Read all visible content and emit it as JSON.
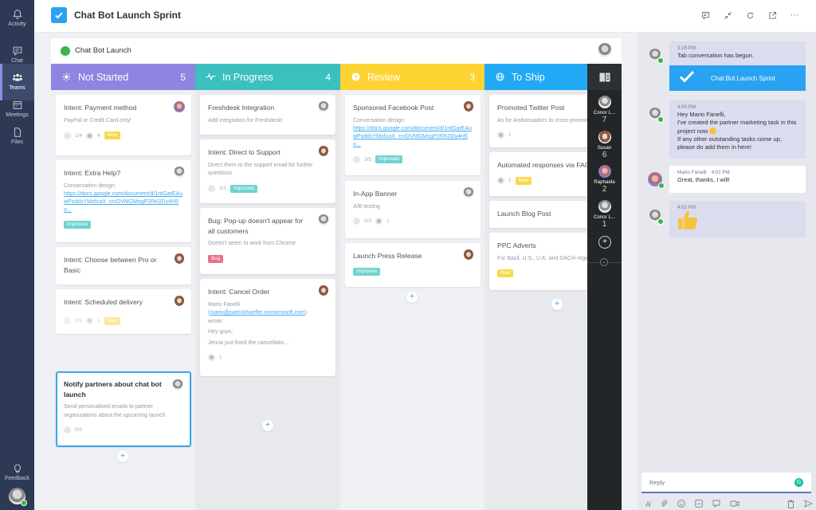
{
  "rail": {
    "items": [
      {
        "label": "Activity",
        "icon": "bell-icon"
      },
      {
        "label": "Chat",
        "icon": "chat-icon"
      },
      {
        "label": "Teams",
        "icon": "teams-icon",
        "active": true
      },
      {
        "label": "Meetings",
        "icon": "calendar-icon"
      },
      {
        "label": "Files",
        "icon": "file-icon"
      }
    ],
    "feedback": "Feedback"
  },
  "header": {
    "title": "Chat Bot Launch Sprint",
    "actions": [
      "conversation-icon",
      "collapse-icon",
      "refresh-icon",
      "popout-icon",
      "more-icon"
    ],
    "more": "···"
  },
  "board": {
    "project": "Chat Bot Launch",
    "columns": [
      {
        "name": "Not Started",
        "count": "5",
        "color": "#8f84e0",
        "icon": "lightbulb-icon",
        "cards": [
          {
            "title": "Intent: Payment method",
            "desc": "PayPal or Credit Card only!",
            "checklist": "1/4",
            "comments": "4",
            "tag": "New"
          },
          {
            "title": "Intent: Extra Help?",
            "desc": "Conversation design:",
            "link": "https://docs.google.com/document/d/1ntGarEAuwPxddxYMofcaX_crvDVMGMsgP2RK0Dy4H5o...",
            "tag": "Improved"
          },
          {
            "title": "Intent: Choose between Pro or Basic"
          },
          {
            "title": "Intent: Scheduled delivery",
            "checklist": "0/3",
            "comments": "1",
            "tag": "New"
          },
          {
            "title": "Notify partners about chat bot launch",
            "desc": "Send personalised emails to partner organizations about the upcoming launch",
            "checklist": "0/3"
          }
        ]
      },
      {
        "name": "In Progress",
        "count": "4",
        "color": "#3cbfbf",
        "icon": "activity-icon",
        "cards": [
          {
            "title": "Freshdesk Integration",
            "desc": "Add integration for Freshdesk!"
          },
          {
            "title": "Intent: Direct to Support",
            "desc": "Direct them to the support email for further questions",
            "checklist": "1/3",
            "tag": "Improved"
          },
          {
            "title": "Bug: Pop-up doesn't appear for all customers",
            "desc": "Doesn't seem to work from Chrome",
            "tag": "Bug"
          },
          {
            "title": "Intent: Cancel Order",
            "desc_line1": "Mario Fanelli",
            "email": "mario@patrickhoefler.onmicrosoft.com",
            "desc_line2": "wrote:",
            "desc_line3": "Hey guys,",
            "desc_line4": "Jenna just fixed the cancellatio...",
            "comments": "1"
          }
        ]
      },
      {
        "name": "Review",
        "count": "3",
        "color": "#fdd333",
        "icon": "question-icon",
        "cards": [
          {
            "title": "Sponsored Facebook Post",
            "desc": "Conversation design:",
            "link": "https://docs.google.com/document/d/1ntGarEAuwPxddxYMofcaX_crvDVMGMsgP2RK0Dy4H5o...",
            "checklist": "3/5",
            "tag": "Improved"
          },
          {
            "title": "In-App Banner",
            "desc": "A/B testing",
            "checklist": "0/3",
            "comments": "1"
          },
          {
            "title": "Launch Press Release",
            "tag": "Improved"
          }
        ]
      },
      {
        "name": "To Ship",
        "count": "",
        "color": "#22a9f5",
        "icon": "globe-icon",
        "cards": [
          {
            "title": "Promoted Twitter Post",
            "desc": "As for Ambassadors to cross-promote",
            "comments": "1"
          },
          {
            "title": "Automated responses via FAQ",
            "comments": "2",
            "tag": "New"
          },
          {
            "title": "Launch Blog Post"
          },
          {
            "title": "PPC Adverts",
            "desc": "For Bazil, U.S., U.K. and DACH regions",
            "tag": "New"
          }
        ]
      }
    ],
    "add": "+"
  },
  "members": {
    "people": [
      {
        "name": "Conor L...",
        "count": "7"
      },
      {
        "name": "Susan",
        "count": "6"
      },
      {
        "name": "Raphaela",
        "count": "2"
      },
      {
        "name": "Conor L...",
        "count": "1"
      }
    ],
    "add": "+",
    "expand": "⌄"
  },
  "chat": {
    "messages": [
      {
        "time": "3:16 PM",
        "text": "Tab conversation has begun."
      },
      {
        "card": "Chat Bot Launch Sprint"
      },
      {
        "time": "4:00 PM",
        "lines": [
          "Hey Mario Fanelli,",
          "I've created the partner marketing task in this",
          "project now",
          "If any other outstanding tasks come up,",
          "please do add them in here!"
        ]
      },
      {
        "sender": "Mario Fanelli",
        "time": "4:01 PM",
        "text": "Great, thanks, I will!"
      },
      {
        "time": "4:02 PM",
        "emoji": "thumbs-up"
      }
    ],
    "reply_placeholder": "Reply",
    "tools": [
      "format-icon",
      "attach-icon",
      "emoji-icon",
      "gif-icon",
      "sticker-icon",
      "meet-icon",
      "delete-icon",
      "send-icon"
    ]
  }
}
